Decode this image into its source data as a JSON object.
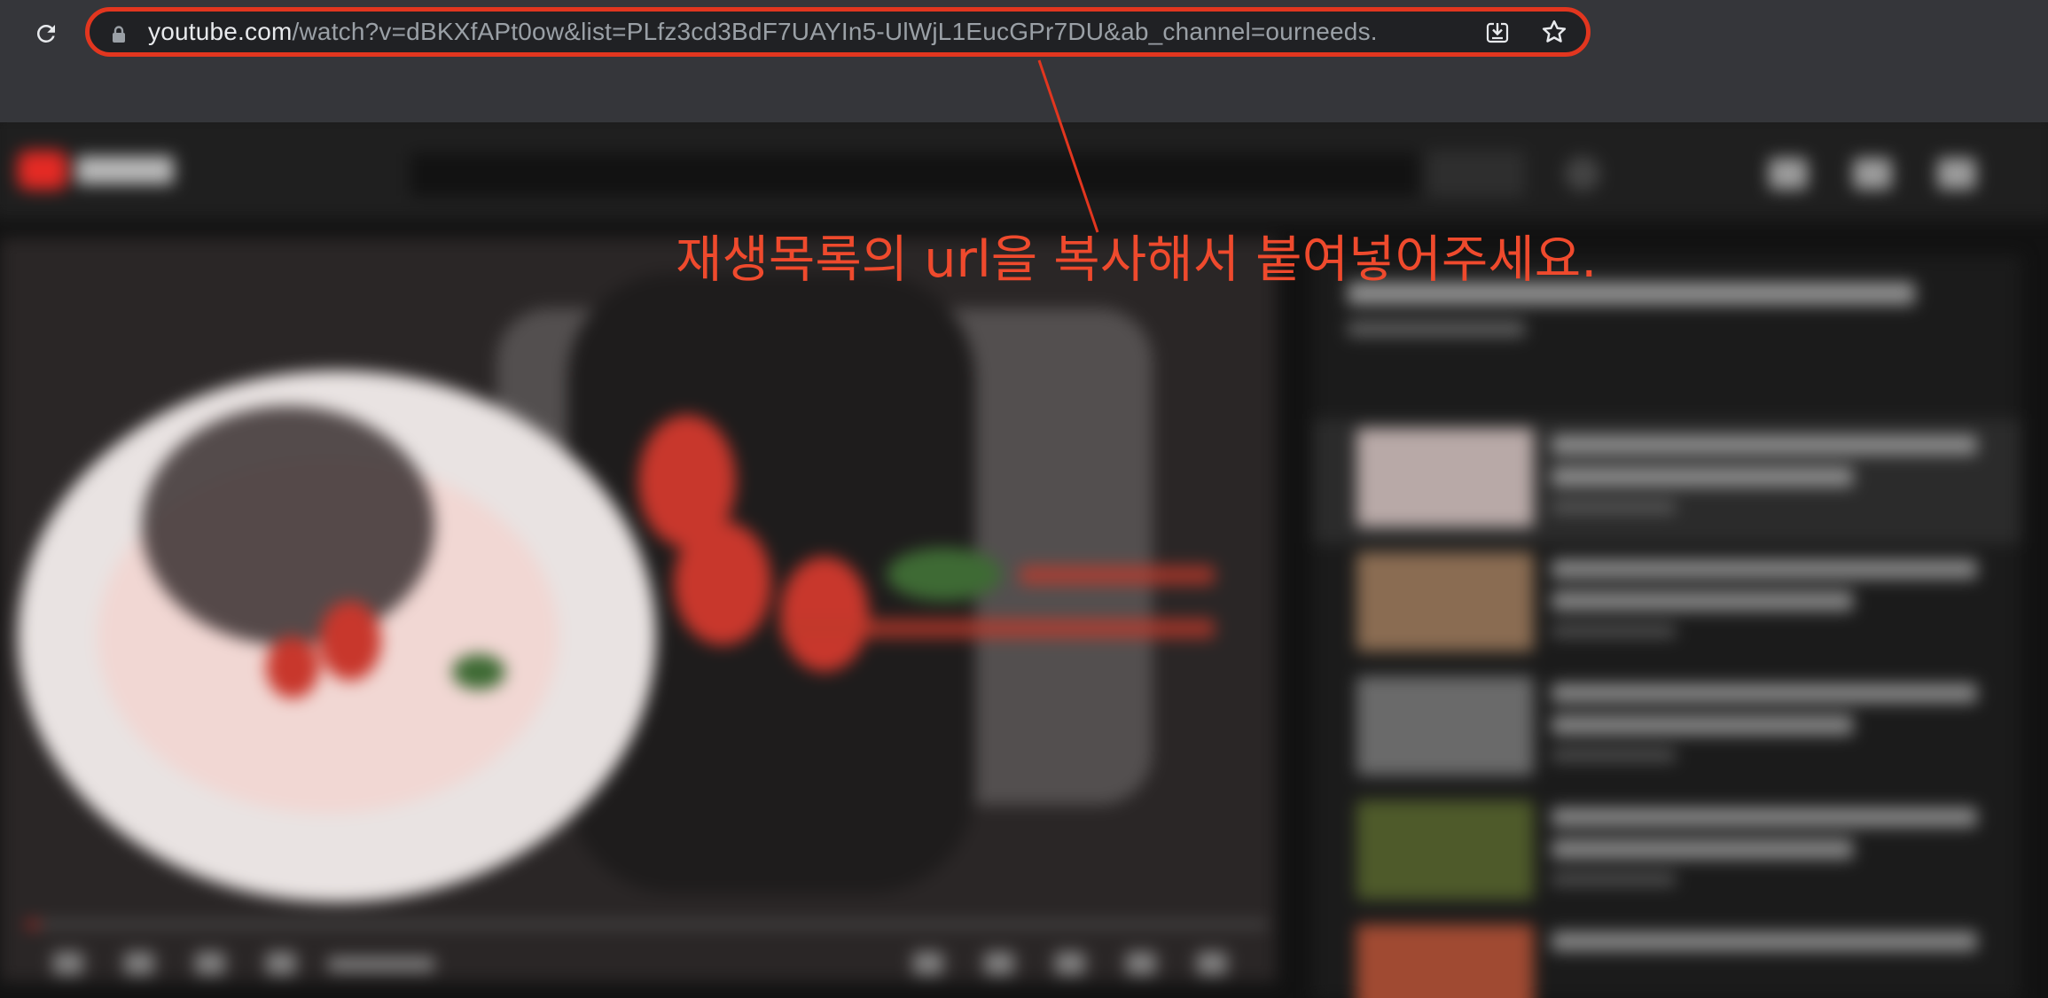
{
  "browser": {
    "url_host": "youtube.com",
    "url_rest": "/watch?v=dBKXfAPt0ow&list=PLfz3cd3BdF7UAYIn5-UlWjL1EucGPr7DU&ab_channel=ourneeds.",
    "icons": [
      "reload-icon",
      "lock-icon",
      "install-app-icon",
      "bookmark-star-icon"
    ]
  },
  "annotation": {
    "text": "재생목록의 url을 복사해서 붙여넣어주세요.",
    "color": "#ef4a2d"
  },
  "colors": {
    "highlight_border": "#e2361f",
    "chrome_bg": "#35363a",
    "omnibox_bg": "#202124"
  }
}
